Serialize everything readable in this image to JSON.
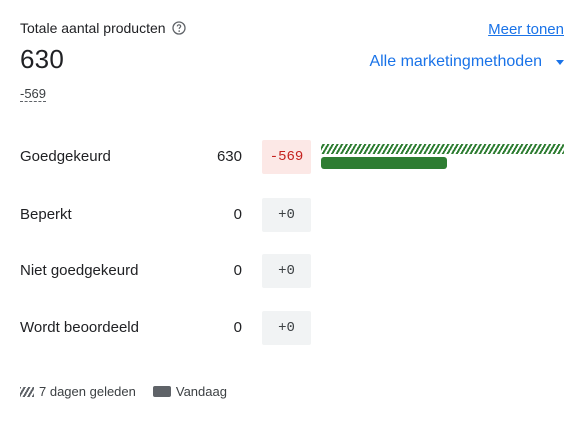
{
  "header": {
    "title": "Totale aantal producten",
    "total": "630",
    "delta": "-569",
    "more_link": "Meer tonen",
    "methods_select": "Alle marketingmethoden"
  },
  "rows": [
    {
      "label": "Goedgekeurd",
      "count": "630",
      "change": "-569"
    },
    {
      "label": "Beperkt",
      "count": "0",
      "change": "+0"
    },
    {
      "label": "Niet goedgekeurd",
      "count": "0",
      "change": "+0"
    },
    {
      "label": "Wordt beoordeeld",
      "count": "0",
      "change": "+0"
    }
  ],
  "chart_data": {
    "type": "bar",
    "categories": [
      "Goedgekeurd",
      "Beperkt",
      "Niet goedgekeurd",
      "Wordt beoordeeld"
    ],
    "series": [
      {
        "name": "7 dagen geleden",
        "values": [
          1199,
          0,
          0,
          0
        ]
      },
      {
        "name": "Vandaag",
        "values": [
          630,
          0,
          0,
          0
        ]
      }
    ]
  },
  "legend": {
    "past": "7 dagen geleden",
    "today": "Vandaag"
  },
  "colors": {
    "accent": "#1a73e8",
    "bar": "#2e7d32",
    "negative": "#c5221f",
    "negative_bg": "#fce8e6"
  },
  "icons": {
    "help": "help-circle-icon",
    "dropdown": "caret-down-icon"
  }
}
